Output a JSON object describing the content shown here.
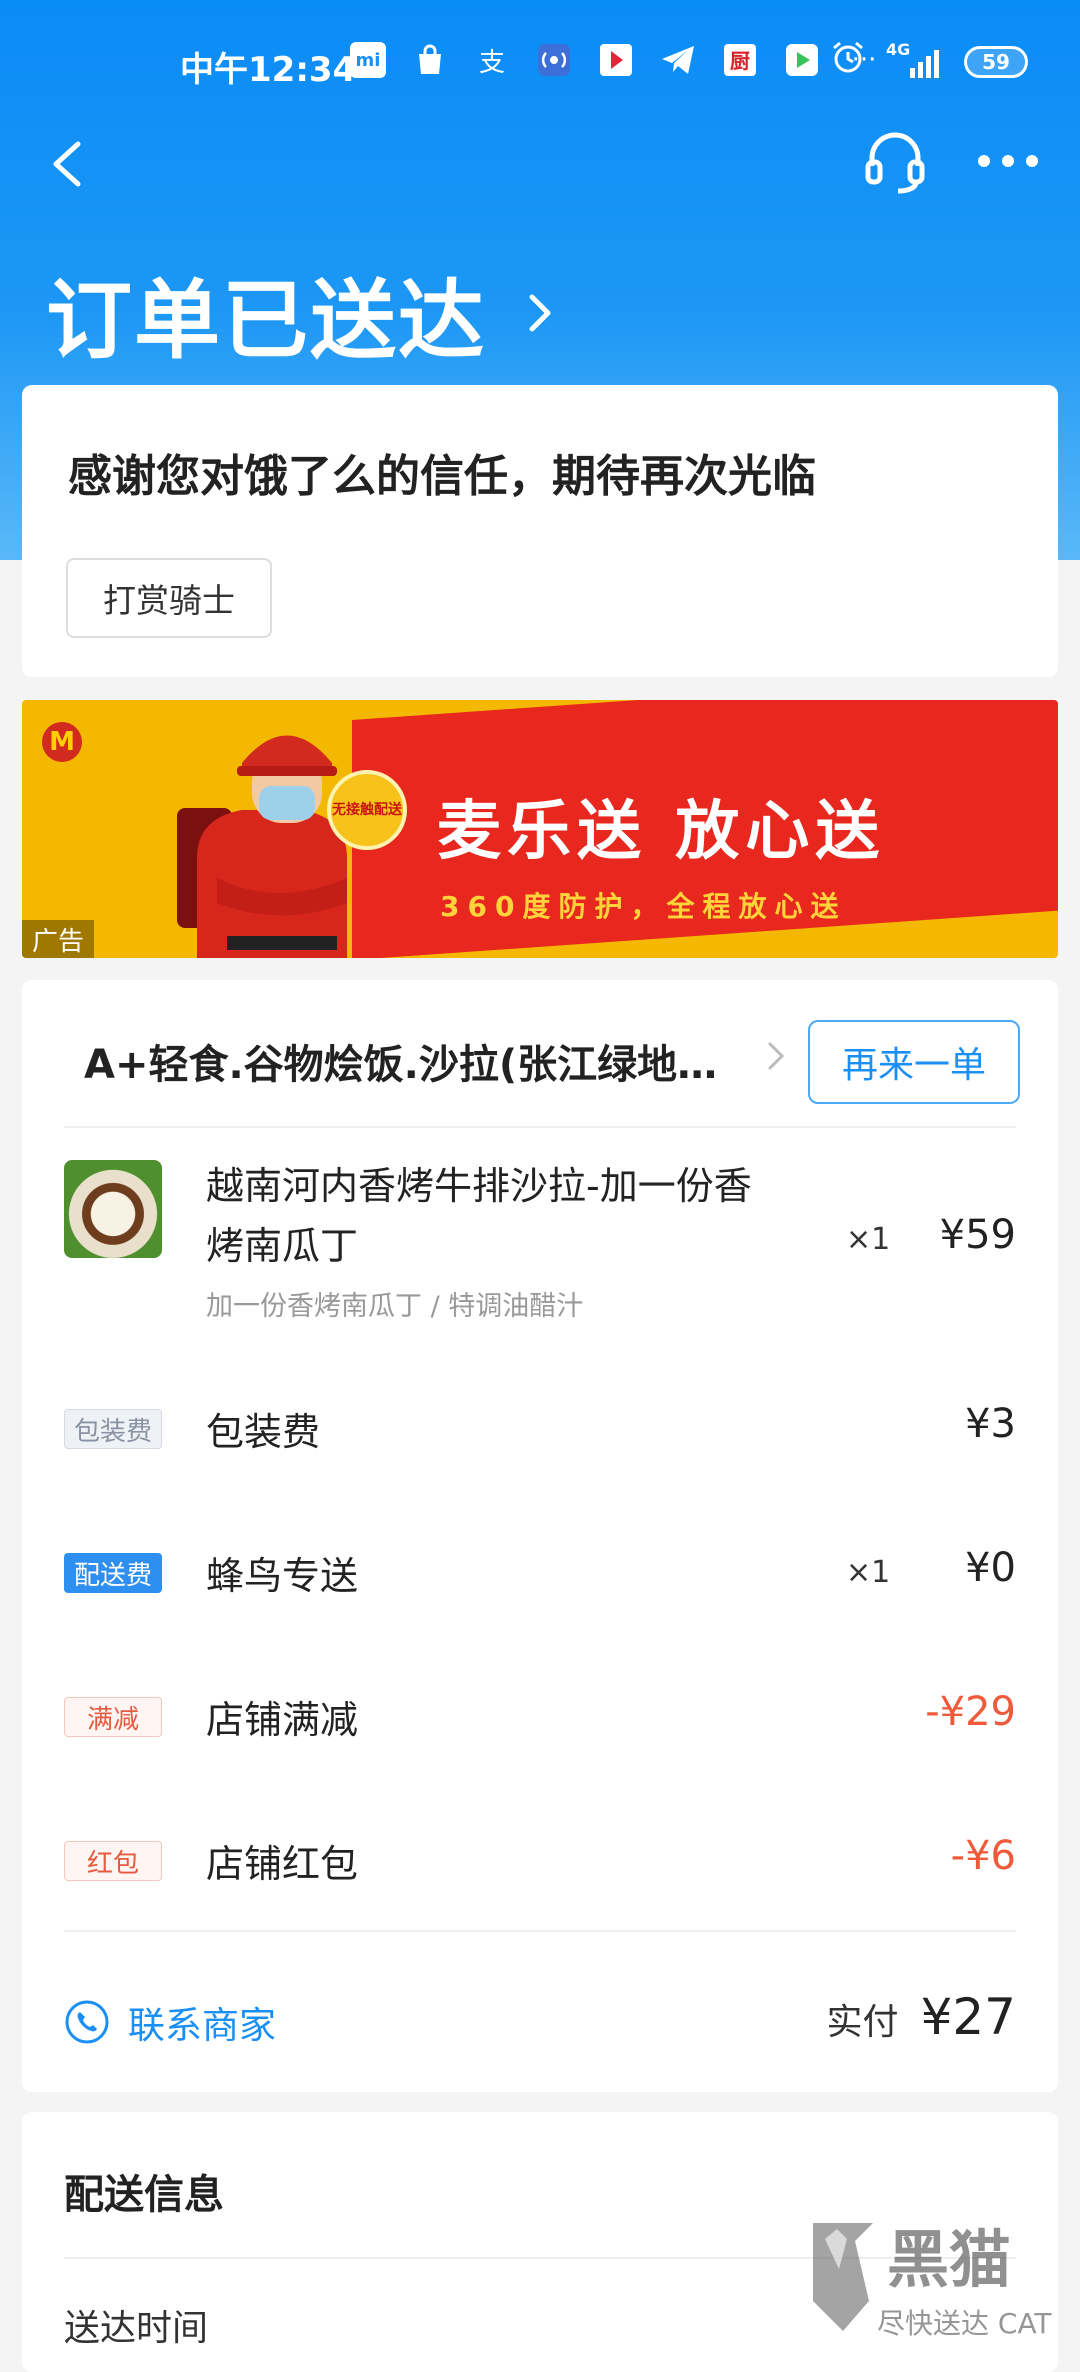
{
  "status_bar": {
    "time": "中午12:34",
    "network": "4G",
    "battery": "59",
    "app_icons": [
      "mi-icon",
      "bag-icon",
      "alipay-icon",
      "nfc-icon",
      "youku-icon",
      "telegram-icon",
      "kitchen-icon",
      "video-icon"
    ],
    "more": "···"
  },
  "header": {
    "title": "订单已送达"
  },
  "thanks": {
    "message": "感谢您对饿了么的信任，期待再次光临",
    "reward_button": "打赏骑士"
  },
  "ad": {
    "badge": "无接触配送",
    "slogan": "麦乐送 放心送",
    "sub": "360度防护，全程放心送",
    "tag": "广告",
    "colors": {
      "yellow": "#f5b800",
      "red": "#e8281f"
    }
  },
  "order": {
    "shop_name": "A+轻食.谷物烩饭.沙拉(张江绿地缤纷城店)",
    "reorder_button": "再来一单",
    "items": [
      {
        "name": "越南河内香烤牛排沙拉-加一份香烤南瓜丁",
        "options": "加一份香烤南瓜丁 / 特调油醋汁",
        "qty": "×1",
        "price": "¥59"
      }
    ],
    "fees": [
      {
        "tag": "包装费",
        "label": "包装费",
        "qty": "",
        "amount": "¥3"
      },
      {
        "tag": "配送费",
        "label": "蜂鸟专送",
        "qty": "×1",
        "amount": "¥0"
      },
      {
        "tag": "满减",
        "label": "店铺满减",
        "qty": "",
        "amount": "-¥29"
      },
      {
        "tag": "红包",
        "label": "店铺红包",
        "qty": "",
        "amount": "-¥6"
      }
    ],
    "contact": "联系商家",
    "paid_label": "实付",
    "paid_value": "¥27"
  },
  "delivery": {
    "title": "配送信息",
    "time_label": "送达时间"
  },
  "watermark": {
    "brand": "黑猫",
    "sub": "尽快送达 CAT"
  },
  "accent_color": "#1a8ff5"
}
